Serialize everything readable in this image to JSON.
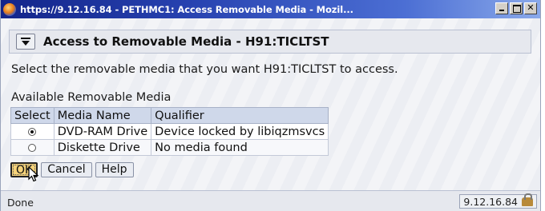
{
  "window": {
    "title": "https://9.12.16.84 - PETHMC1: Access Removable Media - Mozil...",
    "controls": [
      "minimize",
      "maximize",
      "close"
    ]
  },
  "dialog": {
    "title": "Access to Removable Media - H91:TICLTST",
    "instructions": "Select the removable media that you want H91:TICLTST to access.",
    "table_caption": "Available Removable Media",
    "columns": [
      "Select",
      "Media Name",
      "Qualifier"
    ],
    "rows": [
      {
        "selected": true,
        "media_name": "DVD-RAM Drive",
        "qualifier": "Device locked by libiqzmsvcs"
      },
      {
        "selected": false,
        "media_name": "Diskette Drive",
        "qualifier": "No media found"
      }
    ],
    "buttons": {
      "ok": "OK",
      "cancel": "Cancel",
      "help": "Help"
    }
  },
  "status_bar": {
    "left": "Done",
    "right": "9.12.16.84",
    "security_icon": "lock-icon"
  },
  "colors": {
    "title_bar_start": "#13258a",
    "title_bar_end": "#8aa9ea",
    "ok_button": "#f6d37a",
    "table_header": "#cfd8ea"
  }
}
